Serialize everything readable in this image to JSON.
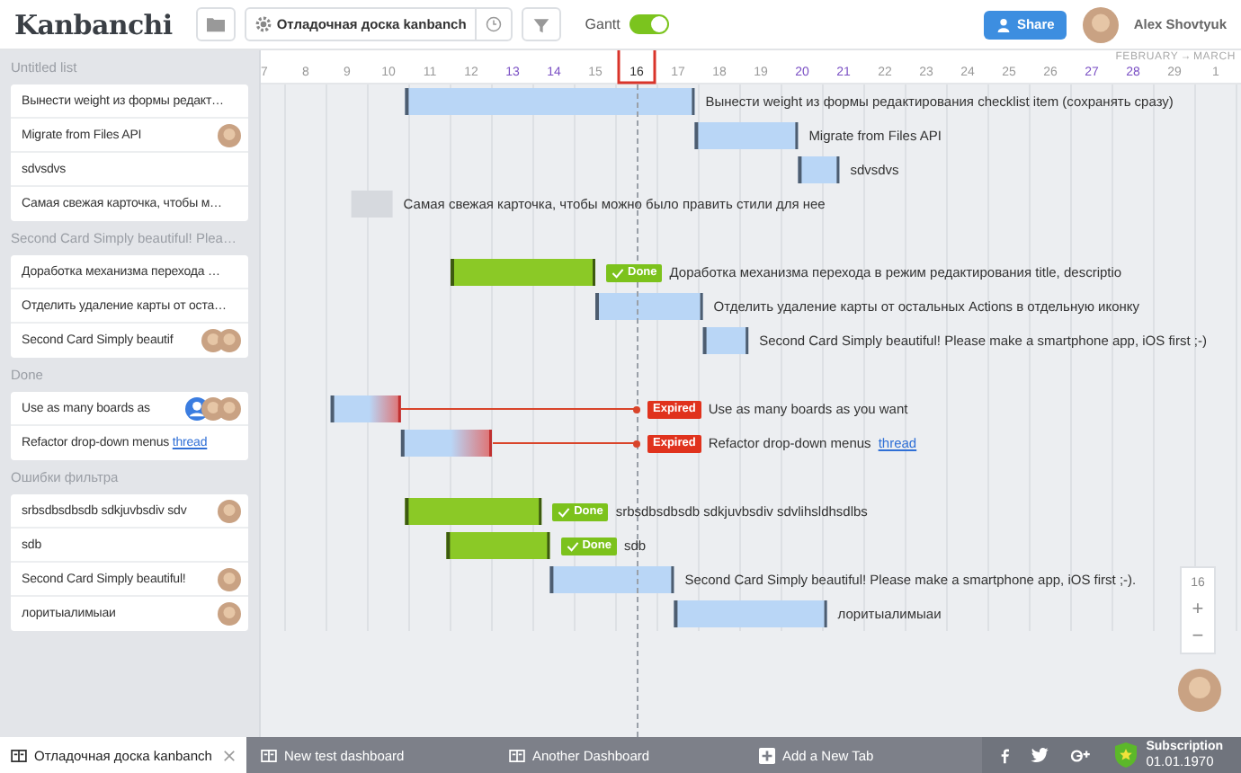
{
  "header": {
    "logo": "Kanbanchi",
    "board_name": "Отладочная доска kanbanch",
    "gantt_toggle": {
      "label": "Gantt",
      "on": true
    },
    "share_button": "Share",
    "user_name": "Alex Shovtyuk"
  },
  "timeline": {
    "month_from": "FEBRUARY",
    "arrow": "→",
    "month_to": "MARCH",
    "days": [
      {
        "label": "7",
        "weekend": false,
        "today": false
      },
      {
        "label": "8",
        "weekend": false,
        "today": false
      },
      {
        "label": "9",
        "weekend": false,
        "today": false
      },
      {
        "label": "10",
        "weekend": false,
        "today": false
      },
      {
        "label": "11",
        "weekend": false,
        "today": false
      },
      {
        "label": "12",
        "weekend": false,
        "today": false
      },
      {
        "label": "13",
        "weekend": true,
        "today": false
      },
      {
        "label": "14",
        "weekend": true,
        "today": false
      },
      {
        "label": "15",
        "weekend": false,
        "today": false
      },
      {
        "label": "16",
        "weekend": false,
        "today": true
      },
      {
        "label": "17",
        "weekend": false,
        "today": false
      },
      {
        "label": "18",
        "weekend": false,
        "today": false
      },
      {
        "label": "19",
        "weekend": false,
        "today": false
      },
      {
        "label": "20",
        "weekend": true,
        "today": false
      },
      {
        "label": "21",
        "weekend": true,
        "today": false
      },
      {
        "label": "22",
        "weekend": false,
        "today": false
      },
      {
        "label": "23",
        "weekend": false,
        "today": false
      },
      {
        "label": "24",
        "weekend": false,
        "today": false
      },
      {
        "label": "25",
        "weekend": false,
        "today": false
      },
      {
        "label": "26",
        "weekend": false,
        "today": false
      },
      {
        "label": "27",
        "weekend": true,
        "today": false
      },
      {
        "label": "28",
        "weekend": true,
        "today": false
      },
      {
        "label": "29",
        "weekend": false,
        "today": false
      },
      {
        "label": "1",
        "weekend": false,
        "today": false
      }
    ]
  },
  "lists": [
    {
      "title": "Untitled list",
      "cards": [
        {
          "title": "Вынести weight из формы редакт…",
          "bar": {
            "kind": "task",
            "done": false,
            "expired": false,
            "label": "Вынести weight из формы редактирования checklist item (сохранять сразу)"
          }
        },
        {
          "title": "Migrate from Files API",
          "assignees": [
            {
              "kind": "photo"
            }
          ],
          "bar": {
            "kind": "task",
            "done": false,
            "expired": false,
            "label": "Migrate from Files API"
          }
        },
        {
          "title": "sdvsdvs",
          "bar": {
            "kind": "task",
            "done": false,
            "expired": false,
            "label": "sdvsdvs"
          }
        },
        {
          "title": "Самая свежая карточка, чтобы м…",
          "bar": {
            "kind": "unscheduled",
            "label": "Самая свежая карточка, чтобы можно было править стили для нее"
          }
        }
      ]
    },
    {
      "title": "Second Card Simply beautiful! Plea…",
      "cards": [
        {
          "title": "Доработка механизма перехода …",
          "bar": {
            "kind": "task",
            "done": true,
            "expired": false,
            "badge": "Done",
            "label": "Доработка механизма перехода в режим редактирования title, descriptio"
          }
        },
        {
          "title": "Отделить удаление карты от оста…",
          "bar": {
            "kind": "task",
            "done": false,
            "expired": false,
            "label": "Отделить удаление карты от остальных Actions в отдельную иконку"
          }
        },
        {
          "title": "Second Card Simply beautif",
          "assignees": [
            {
              "kind": "photo"
            },
            {
              "kind": "photo"
            }
          ],
          "bar": {
            "kind": "task",
            "done": false,
            "expired": false,
            "label": "Second Card Simply beautiful! Please make a smartphone app, iOS first ;-)"
          }
        }
      ]
    },
    {
      "title": "Done",
      "cards": [
        {
          "title": "Use as many boards as",
          "assignees": [
            {
              "kind": "silhouette"
            },
            {
              "kind": "photo"
            },
            {
              "kind": "photo"
            }
          ],
          "bar": {
            "kind": "task",
            "done": false,
            "expired": true,
            "badge": "Expired",
            "label": "Use as many boards as you want"
          }
        },
        {
          "title": "Refactor drop-down menus",
          "link": "thread",
          "bar": {
            "kind": "task",
            "done": false,
            "expired": true,
            "badge": "Expired",
            "label": "Refactor drop-down menus",
            "link": "thread"
          }
        }
      ]
    },
    {
      "title": "Ошибки фильтра",
      "cards": [
        {
          "title": "srbsdbsdbsdb sdkjuvbsdiv sdv",
          "assignees": [
            {
              "kind": "photo"
            }
          ],
          "bar": {
            "kind": "task",
            "done": true,
            "expired": false,
            "badge": "Done",
            "label": "srbsdbsdbsdb sdkjuvbsdiv sdvlihsldhsdlbs"
          }
        },
        {
          "title": "sdb",
          "bar": {
            "kind": "task",
            "done": true,
            "expired": false,
            "badge": "Done",
            "label": "sdb"
          }
        },
        {
          "title": "Second Card Simply beautiful!",
          "assignees": [
            {
              "kind": "photo"
            }
          ],
          "bar": {
            "kind": "task",
            "done": false,
            "expired": false,
            "label": "Second Card Simply beautiful! Please make a smartphone app, iOS first ;-)."
          }
        },
        {
          "title": "лоритыалимыаи",
          "assignees": [
            {
              "kind": "photo"
            }
          ],
          "bar": {
            "kind": "task",
            "done": false,
            "expired": false,
            "label": "лоритыалимыаи"
          }
        }
      ]
    }
  ],
  "zoom_control": {
    "value": "16",
    "zoom_in": "+",
    "zoom_out": "−"
  },
  "tabs": [
    {
      "label": "Отладочная доска kanbanch",
      "selected": true,
      "closable": true
    },
    {
      "label": "New test dashboard",
      "selected": false,
      "closable": false
    },
    {
      "label": "Another Dashboard",
      "selected": false,
      "closable": false
    }
  ],
  "add_tab": "Add a New Tab",
  "subscription": {
    "title": "Subscription",
    "date": "01.01.1970"
  }
}
